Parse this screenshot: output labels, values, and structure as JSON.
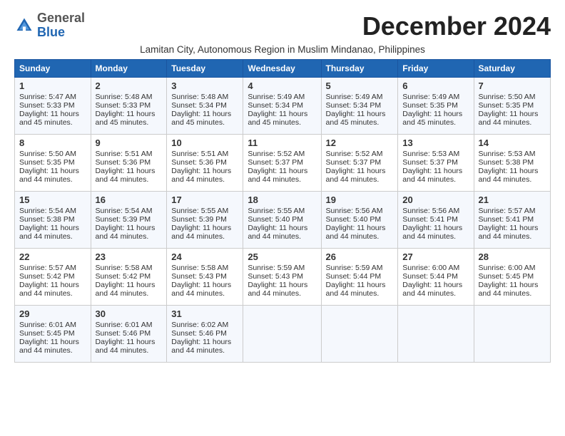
{
  "logo": {
    "general": "General",
    "blue": "Blue"
  },
  "title": "December 2024",
  "subtitle": "Lamitan City, Autonomous Region in Muslim Mindanao, Philippines",
  "days_of_week": [
    "Sunday",
    "Monday",
    "Tuesday",
    "Wednesday",
    "Thursday",
    "Friday",
    "Saturday"
  ],
  "weeks": [
    [
      {
        "day": "1",
        "sunrise": "5:47 AM",
        "sunset": "5:33 PM",
        "daylight": "11 hours and 45 minutes."
      },
      {
        "day": "2",
        "sunrise": "5:48 AM",
        "sunset": "5:33 PM",
        "daylight": "11 hours and 45 minutes."
      },
      {
        "day": "3",
        "sunrise": "5:48 AM",
        "sunset": "5:34 PM",
        "daylight": "11 hours and 45 minutes."
      },
      {
        "day": "4",
        "sunrise": "5:49 AM",
        "sunset": "5:34 PM",
        "daylight": "11 hours and 45 minutes."
      },
      {
        "day": "5",
        "sunrise": "5:49 AM",
        "sunset": "5:34 PM",
        "daylight": "11 hours and 45 minutes."
      },
      {
        "day": "6",
        "sunrise": "5:49 AM",
        "sunset": "5:35 PM",
        "daylight": "11 hours and 45 minutes."
      },
      {
        "day": "7",
        "sunrise": "5:50 AM",
        "sunset": "5:35 PM",
        "daylight": "11 hours and 44 minutes."
      }
    ],
    [
      {
        "day": "8",
        "sunrise": "5:50 AM",
        "sunset": "5:35 PM",
        "daylight": "11 hours and 44 minutes."
      },
      {
        "day": "9",
        "sunrise": "5:51 AM",
        "sunset": "5:36 PM",
        "daylight": "11 hours and 44 minutes."
      },
      {
        "day": "10",
        "sunrise": "5:51 AM",
        "sunset": "5:36 PM",
        "daylight": "11 hours and 44 minutes."
      },
      {
        "day": "11",
        "sunrise": "5:52 AM",
        "sunset": "5:37 PM",
        "daylight": "11 hours and 44 minutes."
      },
      {
        "day": "12",
        "sunrise": "5:52 AM",
        "sunset": "5:37 PM",
        "daylight": "11 hours and 44 minutes."
      },
      {
        "day": "13",
        "sunrise": "5:53 AM",
        "sunset": "5:37 PM",
        "daylight": "11 hours and 44 minutes."
      },
      {
        "day": "14",
        "sunrise": "5:53 AM",
        "sunset": "5:38 PM",
        "daylight": "11 hours and 44 minutes."
      }
    ],
    [
      {
        "day": "15",
        "sunrise": "5:54 AM",
        "sunset": "5:38 PM",
        "daylight": "11 hours and 44 minutes."
      },
      {
        "day": "16",
        "sunrise": "5:54 AM",
        "sunset": "5:39 PM",
        "daylight": "11 hours and 44 minutes."
      },
      {
        "day": "17",
        "sunrise": "5:55 AM",
        "sunset": "5:39 PM",
        "daylight": "11 hours and 44 minutes."
      },
      {
        "day": "18",
        "sunrise": "5:55 AM",
        "sunset": "5:40 PM",
        "daylight": "11 hours and 44 minutes."
      },
      {
        "day": "19",
        "sunrise": "5:56 AM",
        "sunset": "5:40 PM",
        "daylight": "11 hours and 44 minutes."
      },
      {
        "day": "20",
        "sunrise": "5:56 AM",
        "sunset": "5:41 PM",
        "daylight": "11 hours and 44 minutes."
      },
      {
        "day": "21",
        "sunrise": "5:57 AM",
        "sunset": "5:41 PM",
        "daylight": "11 hours and 44 minutes."
      }
    ],
    [
      {
        "day": "22",
        "sunrise": "5:57 AM",
        "sunset": "5:42 PM",
        "daylight": "11 hours and 44 minutes."
      },
      {
        "day": "23",
        "sunrise": "5:58 AM",
        "sunset": "5:42 PM",
        "daylight": "11 hours and 44 minutes."
      },
      {
        "day": "24",
        "sunrise": "5:58 AM",
        "sunset": "5:43 PM",
        "daylight": "11 hours and 44 minutes."
      },
      {
        "day": "25",
        "sunrise": "5:59 AM",
        "sunset": "5:43 PM",
        "daylight": "11 hours and 44 minutes."
      },
      {
        "day": "26",
        "sunrise": "5:59 AM",
        "sunset": "5:44 PM",
        "daylight": "11 hours and 44 minutes."
      },
      {
        "day": "27",
        "sunrise": "6:00 AM",
        "sunset": "5:44 PM",
        "daylight": "11 hours and 44 minutes."
      },
      {
        "day": "28",
        "sunrise": "6:00 AM",
        "sunset": "5:45 PM",
        "daylight": "11 hours and 44 minutes."
      }
    ],
    [
      {
        "day": "29",
        "sunrise": "6:01 AM",
        "sunset": "5:45 PM",
        "daylight": "11 hours and 44 minutes."
      },
      {
        "day": "30",
        "sunrise": "6:01 AM",
        "sunset": "5:46 PM",
        "daylight": "11 hours and 44 minutes."
      },
      {
        "day": "31",
        "sunrise": "6:02 AM",
        "sunset": "5:46 PM",
        "daylight": "11 hours and 44 minutes."
      },
      null,
      null,
      null,
      null
    ]
  ]
}
